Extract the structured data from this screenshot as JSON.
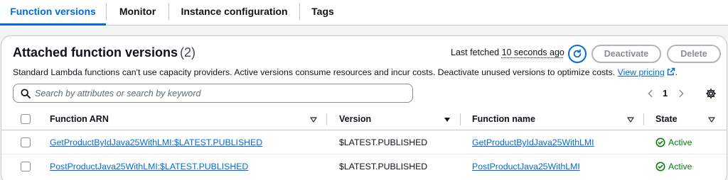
{
  "tabs": [
    {
      "label": "Function versions",
      "active": true
    },
    {
      "label": "Monitor",
      "active": false
    },
    {
      "label": "Instance configuration",
      "active": false
    },
    {
      "label": "Tags",
      "active": false
    }
  ],
  "header": {
    "title": "Attached function versions",
    "count": "(2)",
    "last_fetched_label": "Last fetched",
    "last_fetched_value": "10 seconds ago",
    "refresh_icon": "refresh-icon",
    "deactivate_label": "Deactivate",
    "delete_label": "Delete"
  },
  "description": {
    "text": "Standard Lambda functions can't use capacity providers. Active versions consume resources and incur costs. Deactivate unused versions to optimize costs.",
    "link_label": "View pricing",
    "link_icon": "external-link-icon",
    "trailing": "."
  },
  "search": {
    "placeholder": "Search by attributes or search by keyword",
    "icon": "search-icon"
  },
  "pagination": {
    "current_page": "1"
  },
  "table": {
    "columns": [
      {
        "label": "Function ARN",
        "sort": "unsorted"
      },
      {
        "label": "Version",
        "sort": "descending"
      },
      {
        "label": "Function name",
        "sort": "unsorted"
      },
      {
        "label": "State",
        "sort": "unsorted"
      }
    ],
    "rows": [
      {
        "arn": "GetProductByIdJava25WithLMI:$LATEST.PUBLISHED",
        "version": "$LATEST.PUBLISHED",
        "name": "GetProductByIdJava25WithLMI",
        "state": "Active"
      },
      {
        "arn": "PostProductJava25WithLMI:$LATEST.PUBLISHED",
        "version": "$LATEST.PUBLISHED",
        "name": "PostProductJava25WithLMI",
        "state": "Active"
      }
    ]
  },
  "colors": {
    "accent": "#006ce0",
    "success": "#037f0c",
    "text": "#0f141a",
    "border": "#c6c6cd",
    "disabled": "#8c8c94"
  }
}
